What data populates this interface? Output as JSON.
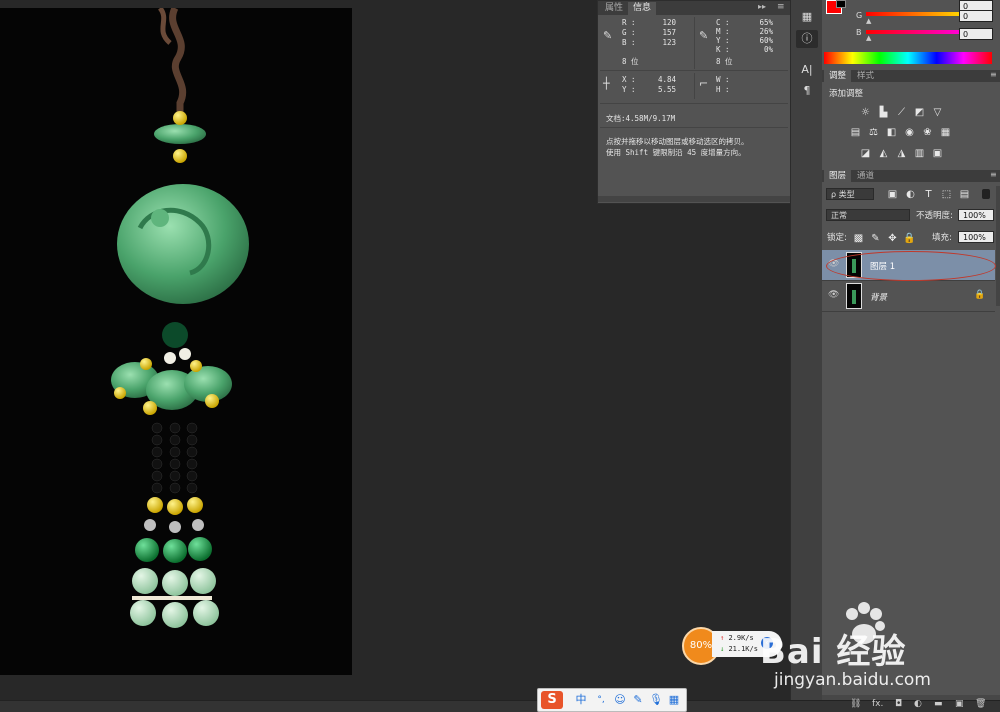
{
  "info_panel": {
    "tabs": [
      "属性",
      "信息"
    ],
    "rgb": {
      "r_label": "R :",
      "r": "120",
      "g_label": "G :",
      "g": "157",
      "b_label": "B :",
      "b": "123"
    },
    "cmyk": {
      "c_label": "C :",
      "c": "65%",
      "m_label": "M :",
      "m": "26%",
      "y_label": "Y :",
      "y": "60%",
      "k_label": "K :",
      "k": "0%"
    },
    "bit_left": "8 位",
    "bit_right": "8 位",
    "xy": {
      "x_label": "X :",
      "x": "4.84",
      "y_label": "Y :",
      "y": "5.55"
    },
    "wh": {
      "w_label": "W :",
      "h_label": "H :"
    },
    "doc": "文档:4.58M/9.17M",
    "hint_line1": "点按并拖移以移动图层或移动选区的拷贝。",
    "hint_line2": "使用 Shift 键限制沿 45 度增量方向。"
  },
  "color_panel": {
    "g_label": "G",
    "g_value": "0",
    "b_label": "B",
    "b_value": "0",
    "top_value": "0",
    "foreground": "#ff0000",
    "background": "#000000"
  },
  "adjustments_panel": {
    "tabs": [
      "调整",
      "样式"
    ],
    "title": "添加调整"
  },
  "layers_panel": {
    "tabs": [
      "图层",
      "通道"
    ],
    "filter_label": "ρ 类型",
    "blend_mode": "正常",
    "opacity_label": "不透明度:",
    "opacity_value": "100%",
    "lock_label": "锁定:",
    "fill_label": "填充:",
    "fill_value": "100%",
    "layers": [
      {
        "name": "图层 1",
        "selected": true
      },
      {
        "name": "背景",
        "selected": false,
        "locked": true
      }
    ]
  },
  "network_widget": {
    "percent": "80%",
    "upload": "2.9K/s",
    "download": "21.1K/s"
  },
  "watermark": {
    "brand": "Bai 经验",
    "url": "jingyan.baidu.com"
  },
  "ime_bar": {
    "logo": "S",
    "mode": "中",
    "punct": "°,"
  }
}
